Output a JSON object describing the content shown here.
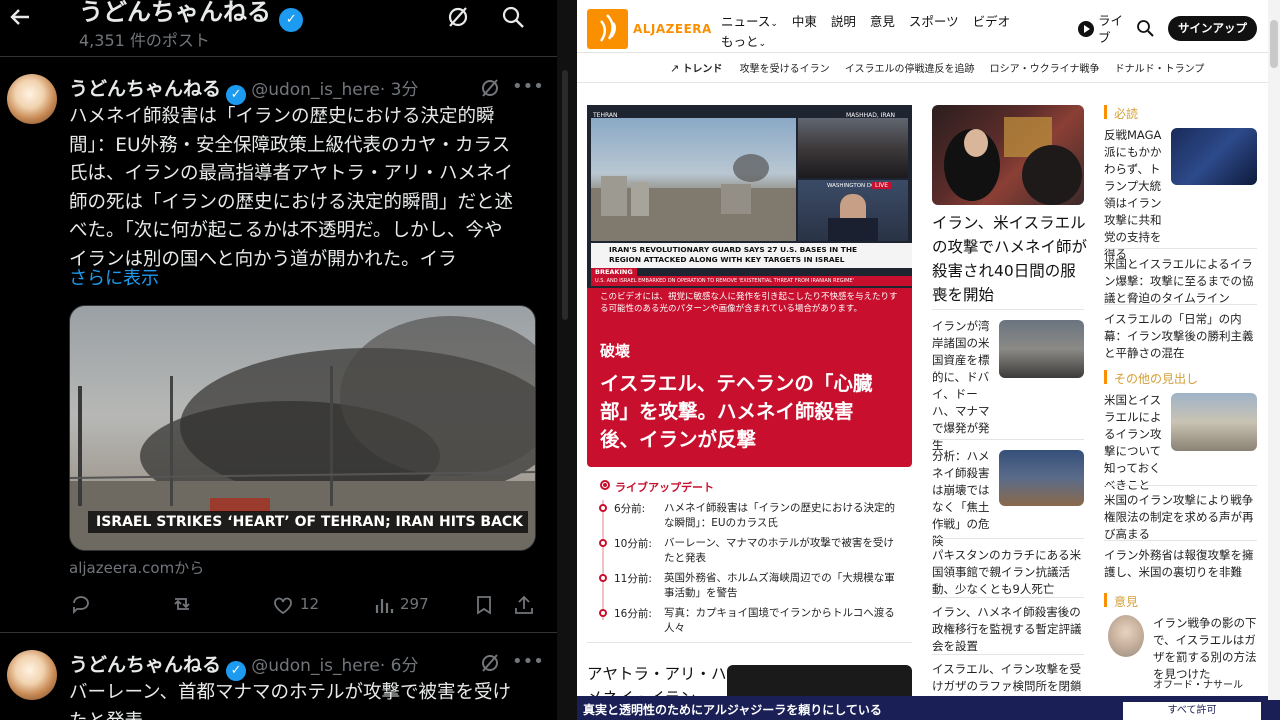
{
  "x": {
    "header": {
      "title": "うどんちゃんねる",
      "post_count": "4,351 件のポスト"
    },
    "post1": {
      "name": "うどんちゃんねる",
      "handle": "@udon_is_here",
      "time": "· 3分",
      "lines": [
        "ハメネイ師殺害は「イランの歴史における決定的瞬",
        "間」：EU外務・安全保障政策上級代表のカヤ・カラス",
        "氏は、イランの最高指導者アヤトラ・アリ・ハメネイ",
        "師の死は「イランの歴史における決定的瞬間」だと述",
        "べた。「次に何が起こるかは不透明だ。しかし、今や",
        "イランは別の国へと向かう道が開かれた。イラ"
      ],
      "show_more": "さらに表示",
      "media_caption": "ISRAEL STRIKES ‘HEART’ OF TEHRAN; IRAN HITS BACK ...",
      "source": "aljazeera.comから",
      "likes": "12",
      "views": "297"
    },
    "post2": {
      "name": "うどんちゃんねる",
      "handle": "@udon_is_here",
      "time": "· 6分",
      "lines": [
        "バーレーン、首都マナマのホテルが攻撃で被害を受け",
        "たと発表"
      ]
    }
  },
  "aj": {
    "logo": "ALJAZEERA",
    "nav": [
      "ニュース",
      "中東",
      "説明",
      "意見",
      "スポーツ",
      "ビデオ",
      "もっと"
    ],
    "live": "ライブ",
    "signup": "サインアップ",
    "trend_label": "トレンド",
    "trends": [
      "攻撃を受けるイラン",
      "イスラエルの停戦違反を追跡",
      "ロシア・ウクライナ戦争",
      "ドナルド・トランプ"
    ],
    "hero": {
      "tag_tehran": "TEHRAN",
      "tag_mashhad": "MASHHAD, IRAN",
      "tag_dc": "WASHINGTON DC",
      "tag_live": "LIVE",
      "ticker1": "IRAN'S REVOLUTIONARY GUARD SAYS 27 U.S. BASES IN THE",
      "ticker2": "REGION ATTACKED ALONG WITH KEY TARGETS IN ISRAEL",
      "breaking": "BREAKING",
      "crawl": "U.S. AND ISRAEL EMBARKED ON OPERATION TO REMOVE 'EXISTENTIAL THREAT FROM IRANIAN REGIME'",
      "warning": "このビデオには、視覚に敏感な人に発作を引き起こしたり不快感を与えたりする可能性のある光のパターンや画像が含まれている場合があります。",
      "kicker": "破壊",
      "title": "イスラエル、テヘランの「心臓部」を攻撃。ハメネイ師殺害後、イランが反撃"
    },
    "live_label": "ライブアップデート",
    "live_items": [
      {
        "time": "6分前:",
        "text": "ハメネイ師殺害は「イランの歴史における決定的な瞬間」：EUのカラス氏"
      },
      {
        "time": "10分前:",
        "text": "バーレーン、マナマのホテルが攻撃で被害を受けたと発表"
      },
      {
        "time": "11分前:",
        "text": "英国外務省、ホルムズ海峡周辺での「大規模な軍事活動」を警告"
      },
      {
        "time": "16分前:",
        "text": "写真：カプキョイ国境でイランからトルコへ渡る人々"
      }
    ],
    "bottom_title": "アヤトラ・アリ・ハメネイ・イラン",
    "col2": {
      "main_title": "イラン、米イスラエルの攻撃でハメネイ師が殺害され40日間の服喪を開始",
      "item1": "イランが湾岸諸国の米国資産を標的に、ドバイ、ドーハ、マナマで爆発が発生",
      "item2": "分析：ハメネイ師殺害は崩壊ではなく「焦土作戦」の危険",
      "item3": "パキスタンのカラチにある米国領事館で親イラン抗議活動、少なくとも9人死亡",
      "item4": "イラン、ハメネイ師殺害後の政権移行を監視する暫定評議会を設置",
      "item5": "イスラエル、イラン攻撃を受けガザのラファ検問所を閉鎖"
    },
    "col3": {
      "must_label": "必読",
      "must1": "反戦MAGA派にもかかわらず、トランプ大統領はイラン攻撃に共和党の支持を得る",
      "must2": "米国とイスラエルによるイラン爆撃：攻撃に至るまでの協議と脅迫のタイムライン",
      "must3": "イスラエルの「日常」の内幕：イラン攻撃後の勝利主義と平静さの混在",
      "other_label": "その他の見出し",
      "other1": "米国とイスラエルによるイラン攻撃について知っておくべきこと",
      "other2": "米国のイラン攻撃により戦争権限法の制定を求める声が再び高まる",
      "other3": "イラン外務省は報復攻撃を擁護し、米国の裏切りを非難",
      "opinion_label": "意見",
      "opinion_text": "イラン戦争の影の下で、イスラエルはガザを罰する別の方法を見つけた",
      "opinion_author": "オフード・ナサール"
    },
    "banner": "真実と透明性のためにアルジャジーラを頼りにしている",
    "banner_button": "すべて許可"
  },
  "colors": {
    "aj_red": "#c8102e",
    "aj_gold": "#fa9000",
    "x_blue": "#1d9bf0"
  }
}
